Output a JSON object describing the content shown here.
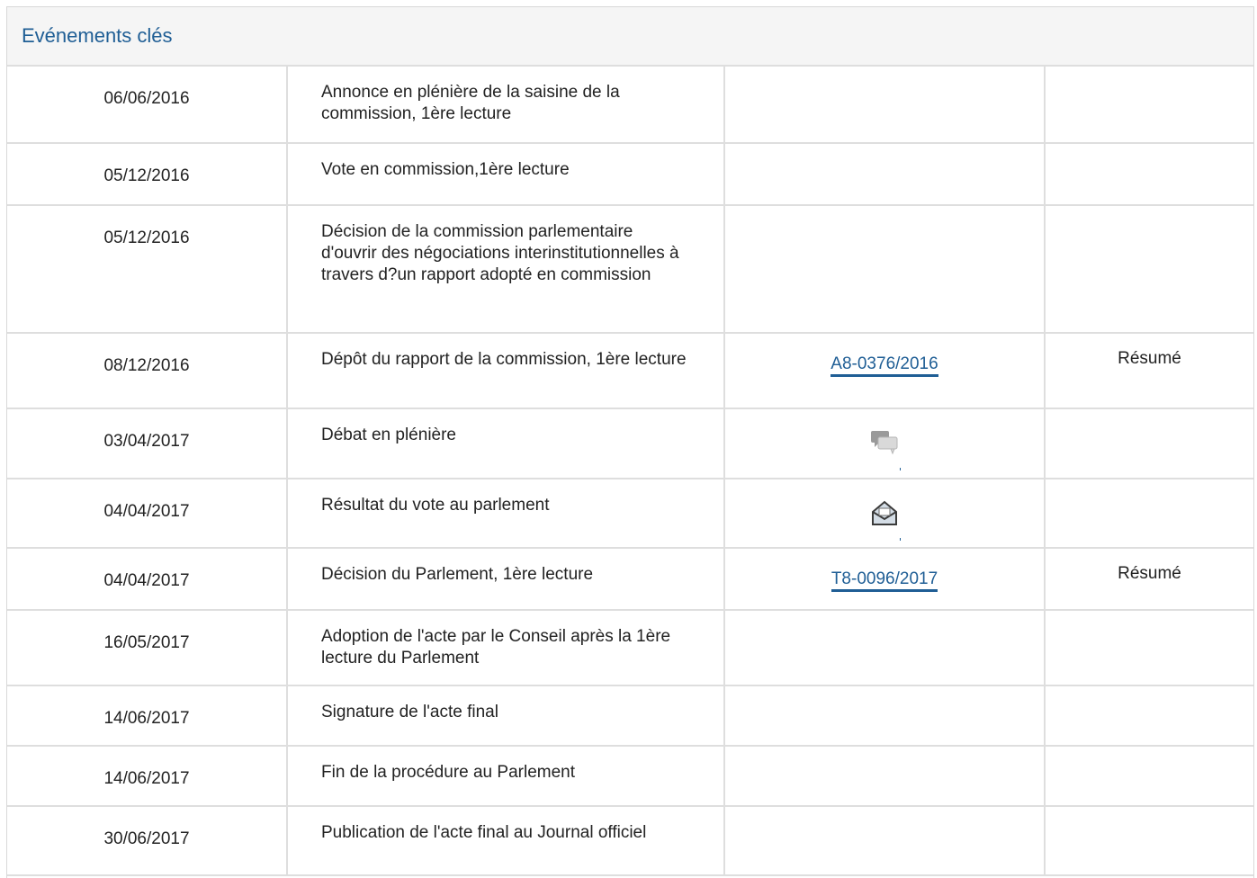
{
  "panel": {
    "title": "Evénements clés"
  },
  "events": [
    {
      "date": "06/06/2016",
      "event": "Annonce en plénière de la saisine de la commission, 1ère lecture",
      "doc": "",
      "summary": "",
      "icon": ""
    },
    {
      "date": "05/12/2016",
      "event": "Vote en commission,1ère lecture",
      "doc": "",
      "summary": "",
      "icon": ""
    },
    {
      "date": "05/12/2016",
      "event": "Décision de la commission parlementaire d'ouvrir des négociations interinstitutionnelles à travers d?un rapport adopté en commission",
      "doc": "",
      "summary": "",
      "icon": ""
    },
    {
      "date": "08/12/2016",
      "event": "Dépôt du rapport de la commission, 1ère lecture",
      "doc": "A8-0376/2016",
      "summary": "Résumé",
      "icon": ""
    },
    {
      "date": "03/04/2017",
      "event": "Débat en plénière",
      "doc": "",
      "summary": "",
      "icon": "debate-speech-bubbles-icon"
    },
    {
      "date": "04/04/2017",
      "event": "Résultat du vote au parlement",
      "doc": "",
      "summary": "",
      "icon": "ballot-box-vote-icon"
    },
    {
      "date": "04/04/2017",
      "event": "Décision du Parlement, 1ère lecture",
      "doc": "T8-0096/2017",
      "summary": "Résumé",
      "icon": ""
    },
    {
      "date": "16/05/2017",
      "event": "Adoption de l'acte par le Conseil après la 1ère lecture du Parlement",
      "doc": "",
      "summary": "",
      "icon": ""
    },
    {
      "date": "14/06/2017",
      "event": "Signature de l'acte final",
      "doc": "",
      "summary": "",
      "icon": ""
    },
    {
      "date": "14/06/2017",
      "event": "Fin de la procédure au Parlement",
      "doc": "",
      "summary": "",
      "icon": ""
    },
    {
      "date": "30/06/2017",
      "event": "Publication de l'acte final au Journal officiel",
      "doc": "",
      "summary": "",
      "icon": ""
    }
  ],
  "colors": {
    "title": "#1f5e95",
    "link": "#1f5e95",
    "border": "#dedede",
    "header_bg": "#f5f5f5"
  }
}
